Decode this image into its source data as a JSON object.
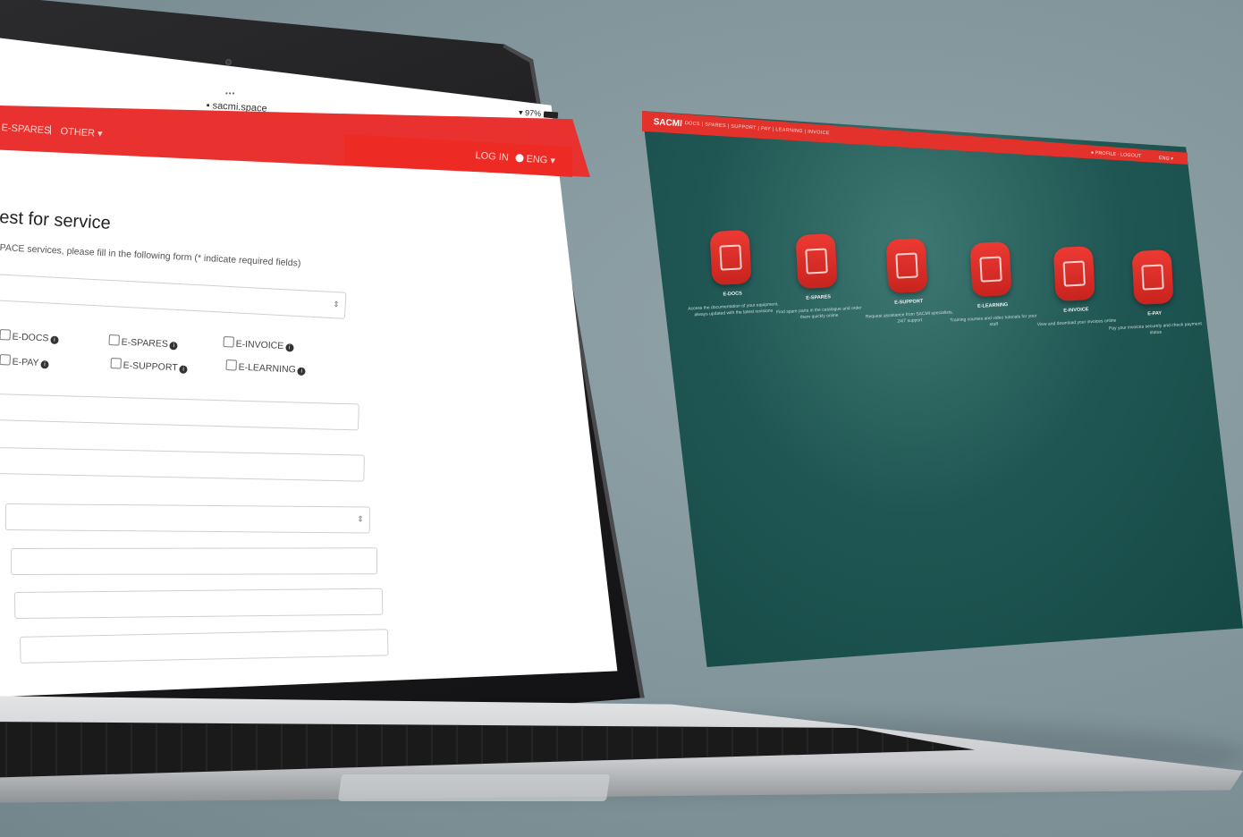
{
  "laptop": {
    "browser": {
      "dots": "•••",
      "url": "sacmi.space",
      "status_right": "97%"
    },
    "navbar": {
      "menu_1": "E-SPARES",
      "separator": "|",
      "menu_2": "OTHER ▾",
      "login": "LOG IN",
      "language": "ENG ▾"
    },
    "form": {
      "title": "est for service",
      "subtitle": "PACE services, please fill in the following form (* indicate required fields)",
      "checkboxes": [
        {
          "label": "E-DOCS"
        },
        {
          "label": "E-SPARES"
        },
        {
          "label": "E-INVOICE"
        },
        {
          "label": "E-PAY"
        },
        {
          "label": "E-SUPPORT"
        },
        {
          "label": "E-LEARNING"
        }
      ],
      "select_arrow": "⇕"
    }
  },
  "floating_screen": {
    "logo": "SACMI",
    "nav": "DOCS  |  SPARES  |  SUPPORT  |  PAY  |  LEARNING  |  INVOICE",
    "right_1": "● PROFILE   ·  LOGOUT",
    "right_2": "ENG ▾",
    "services": [
      {
        "title": "E-DOCS",
        "desc": "Access the documentation of your equipment, always updated with the latest revisions"
      },
      {
        "title": "E-SPARES",
        "desc": "Find spare parts in the catalogue and order them quickly online"
      },
      {
        "title": "E-SUPPORT",
        "desc": "Request assistance from SACMI specialists, 24/7 support"
      },
      {
        "title": "E-LEARNING",
        "desc": "Training courses and video tutorials for your staff"
      },
      {
        "title": "E-INVOICE",
        "desc": "View and download your invoices online"
      },
      {
        "title": "E-PAY",
        "desc": "Pay your invoices securely and check payment status"
      }
    ]
  }
}
